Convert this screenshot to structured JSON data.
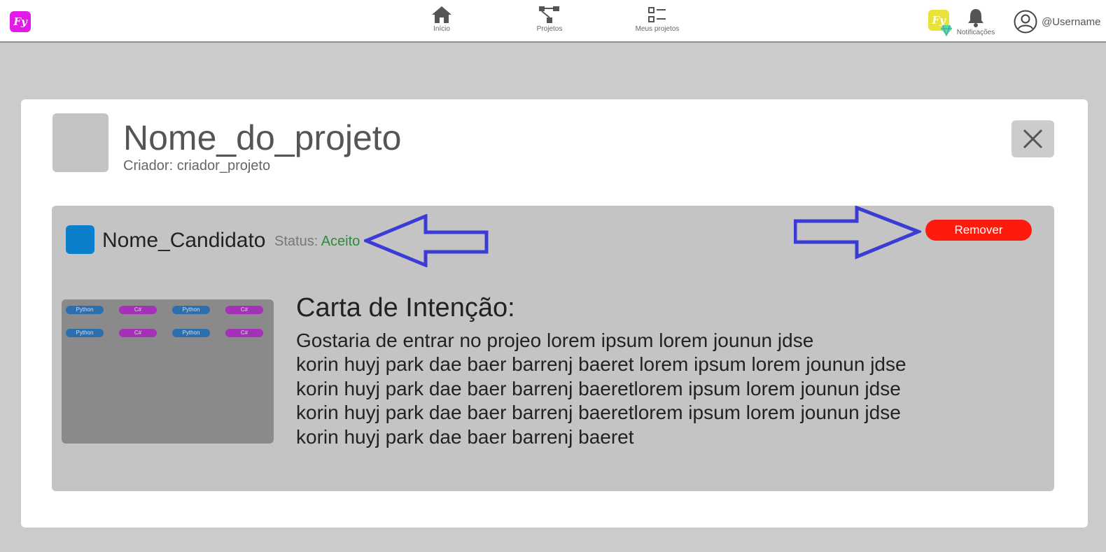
{
  "nav": {
    "logo": "Fy",
    "items": [
      {
        "label": "Início",
        "icon": "home-icon"
      },
      {
        "label": "Projetos",
        "icon": "projects-icon"
      },
      {
        "label": "Meus projetos",
        "icon": "list-icon"
      }
    ],
    "premium_badge": "Fy",
    "notifications_label": "Notificações",
    "username": "@Username"
  },
  "project": {
    "title": "Nome_do_projeto",
    "creator": "Criador: criador_projeto"
  },
  "candidate": {
    "name": "Nome_Candidato",
    "status_label": "Status:",
    "status_value": "Aceito",
    "remove_label": "Remover",
    "skills": [
      "Python",
      "C#",
      "Python",
      "C#",
      "Python",
      "C#",
      "Python",
      "C#"
    ],
    "letter_title": "Carta de Intenção:",
    "letter_lines": [
      "Gostaria de entrar no projeo lorem ipsum lorem jounun jdse",
      "korin huyj park dae baer barrenj baeret lorem ipsum lorem jounun jdse",
      "korin huyj park dae baer barrenj baeretlorem ipsum lorem jounun jdse",
      "korin huyj park dae baer barrenj baeretlorem ipsum lorem jounun jdse",
      "korin huyj park dae baer barrenj baeret"
    ]
  },
  "colors": {
    "logo": "#e21be6",
    "premium": "#e8e23a",
    "candidate_avatar": "#0b7fcb",
    "status_accepted": "#2e8a3e",
    "remove_button": "#ff1a0e",
    "annotation_arrow": "#3b3bd6",
    "skill_python": "#2c6fb0",
    "skill_csharp": "#a431b7"
  }
}
